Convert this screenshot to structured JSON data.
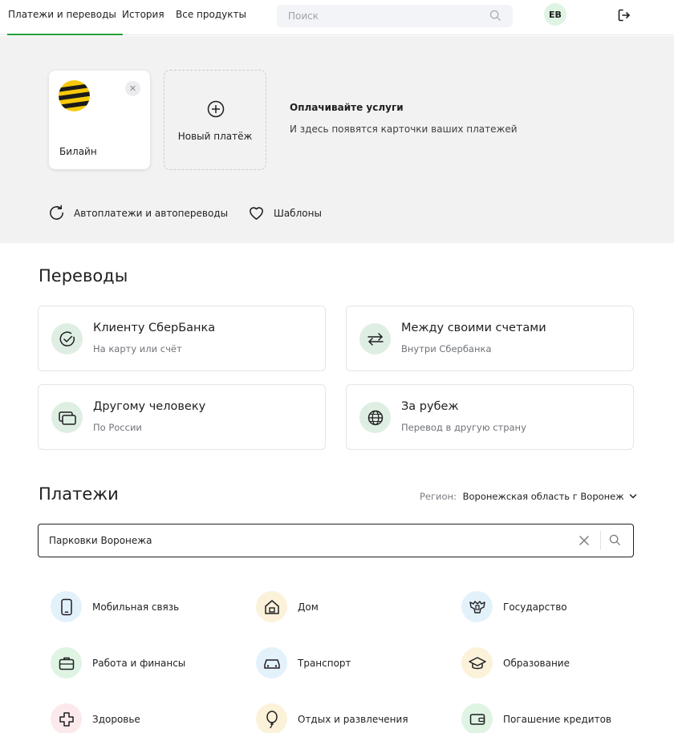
{
  "nav": {
    "tabs": [
      {
        "label": "Платежи и переводы",
        "active": true
      },
      {
        "label": "История",
        "active": false
      },
      {
        "label": "Все продукты",
        "active": false
      }
    ],
    "search_placeholder": "Поиск",
    "avatar_initials": "ЕВ",
    "accent_color": "#21a038"
  },
  "hero": {
    "saved_payment": {
      "name": "Билайн",
      "logo": "beeline-logo"
    },
    "new_payment_label": "Новый платёж",
    "promo_title": "Оплачивайте услуги",
    "promo_subtitle": "И здесь появятся карточки ваших платежей",
    "links": [
      {
        "label": "Автоплатежи и автопереводы",
        "icon": "refresh-icon"
      },
      {
        "label": "Шаблоны",
        "icon": "heart-icon"
      }
    ]
  },
  "transfers": {
    "title": "Переводы",
    "items": [
      {
        "title": "Клиенту СберБанка",
        "subtitle": "На карту или счёт",
        "icon": "sber-check-icon"
      },
      {
        "title": "Между своими счетами",
        "subtitle": "Внутри Сбербанка",
        "icon": "arrows-swap-icon"
      },
      {
        "title": "Другому человеку",
        "subtitle": "По России",
        "icon": "cards-icon"
      },
      {
        "title": "За рубеж",
        "subtitle": "Перевод в другую страну",
        "icon": "globe-icon"
      }
    ]
  },
  "payments": {
    "title": "Платежи",
    "region_label": "Регион:",
    "region_value": "Воронежская область г Воронеж",
    "search_value": "Парковки Воронежа",
    "categories": [
      {
        "label": "Мобильная связь",
        "icon": "phone-icon",
        "color": "#e3f1fb"
      },
      {
        "label": "Дом",
        "icon": "home-icon",
        "color": "#fbf2d9"
      },
      {
        "label": "Государство",
        "icon": "government-emblem-icon",
        "color": "#e3f1fb"
      },
      {
        "label": "Работа и финансы",
        "icon": "briefcase-icon",
        "color": "#dff4e3"
      },
      {
        "label": "Транспорт",
        "icon": "car-icon",
        "color": "#e3f1fb"
      },
      {
        "label": "Образование",
        "icon": "graduation-cap-icon",
        "color": "#fbf2d9"
      },
      {
        "label": "Здоровье",
        "icon": "medical-cross-icon",
        "color": "#fce9ec"
      },
      {
        "label": "Отдых и развлечения",
        "icon": "balloon-icon",
        "color": "#fbf2d9"
      },
      {
        "label": "Погашение кредитов",
        "icon": "wallet-icon",
        "color": "#dff4e3"
      }
    ]
  }
}
